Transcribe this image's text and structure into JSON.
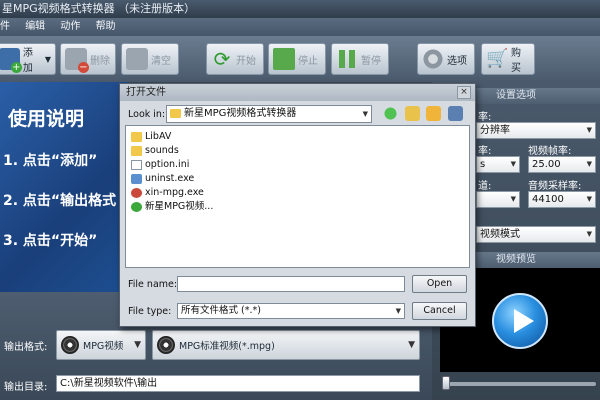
{
  "window": {
    "title": "星MPG视频格式转换器 （未注册版本）"
  },
  "menu": [
    "件",
    "编辑",
    "动作",
    "帮助"
  ],
  "toolbar": {
    "add": "添加",
    "delete": "删除",
    "clear": "清空",
    "start": "开始",
    "stop": "停止",
    "pause": "暂停",
    "options": "选项",
    "buy": "购买"
  },
  "banner": {
    "title": "使用说明",
    "step1": "1. 点击“添加”",
    "step2": "2. 点击“输出格式",
    "step3": "3. 点击“开始”"
  },
  "output": {
    "format_label": "输出格式:",
    "format_type": "MPG视频",
    "format_value": "MPG标准视频(*.mpg)",
    "dir_label": "输出目录:",
    "dir_value": "C:\\新星视频软件\\输出"
  },
  "settings": {
    "header": "设置选项",
    "resolution_label": "率:",
    "resolution_value": "分辨率",
    "fps_label": "视频帧率:",
    "bitrate_label": "率:",
    "bitrate_value": "s",
    "fps_value": "25.00",
    "samplerate_label": "音频采样率:",
    "channel_label": "道:",
    "channel_value": "",
    "samplerate_value": "44100",
    "mode_value": "视频模式",
    "preview_header": "视频预览"
  },
  "dialog": {
    "title": "打开文件",
    "lookin_label": "Look in:",
    "lookin_value": "新星MPG视频格式转换器",
    "files": [
      {
        "name": "LibAV",
        "type": "folder"
      },
      {
        "name": "sounds",
        "type": "folder"
      },
      {
        "name": "option.ini",
        "type": "ini"
      },
      {
        "name": "uninst.exe",
        "type": "exe"
      },
      {
        "name": "xin-mpg.exe",
        "type": "exe2"
      },
      {
        "name": "新星MPG视频...",
        "type": "app"
      }
    ],
    "filename_label": "File name:",
    "filename_value": "",
    "filetype_label": "File type:",
    "filetype_value": "所有文件格式 (*.*)",
    "open_button": "Open",
    "cancel_button": "Cancel",
    "close_glyph": "×"
  }
}
